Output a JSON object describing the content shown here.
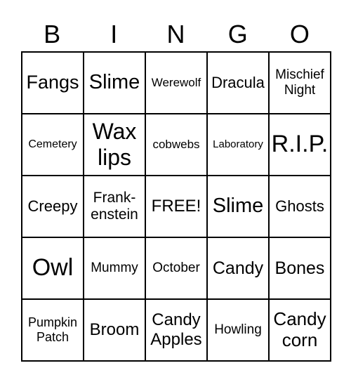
{
  "header": [
    "B",
    "I",
    "N",
    "G",
    "O"
  ],
  "cells": [
    "Fangs",
    "Slime",
    "Werewolf",
    "Dracula",
    "Mischief\nNight",
    "Cemetery",
    "Wax\nlips",
    "cobwebs",
    "Laboratory",
    "R.I.P.",
    "Creepy",
    "Frank-\nenstein",
    "FREE!",
    "Slime",
    "Ghosts",
    "Owl",
    "Mummy",
    "October",
    "Candy",
    "Bones",
    "Pumpkin\nPatch",
    "Broom",
    "Candy\nApples",
    "Howling",
    "Candy\ncorn"
  ]
}
